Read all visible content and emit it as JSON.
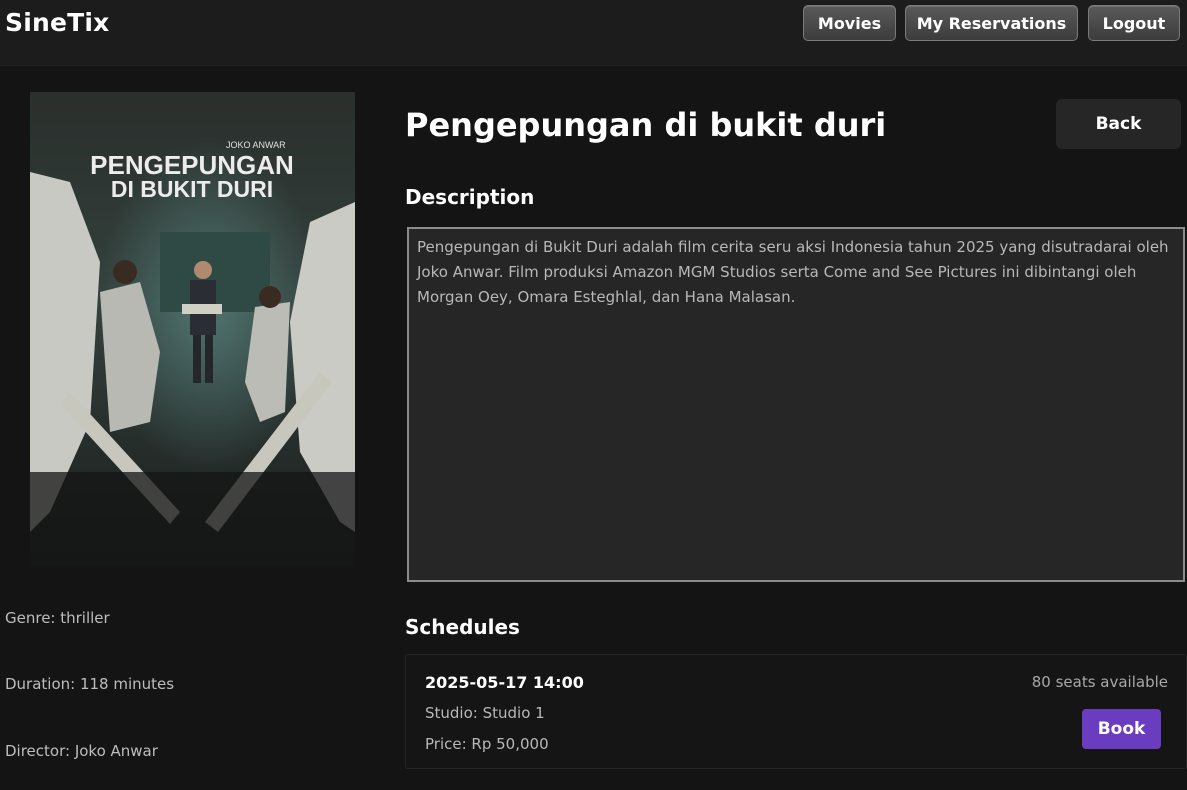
{
  "app": {
    "brand": "SineTix"
  },
  "nav": {
    "movies": "Movies",
    "reservations": "My Reservations",
    "logout": "Logout"
  },
  "movie": {
    "title": "Pengepungan di bukit duri",
    "poster": {
      "icon": "movie-poster-image",
      "title_line1": "PENGEPUNGAN",
      "title_line2": "DI BUKIT DURI",
      "credit": "JOKO ANWAR"
    },
    "genre": "Genre: thriller",
    "duration": "Duration: 118 minutes",
    "director": "Director: Joko Anwar"
  },
  "actions": {
    "back": "Back"
  },
  "description": {
    "heading": "Description",
    "text": "Pengepungan di Bukit Duri adalah film cerita seru aksi Indonesia tahun 2025 yang disutradarai oleh Joko Anwar. Film produksi Amazon MGM Studios serta Come and See Pictures ini dibintangi oleh Morgan Oey, Omara Esteghlal, dan Hana Malasan."
  },
  "schedules": {
    "heading": "Schedules",
    "items": [
      {
        "datetime": "2025-05-17 14:00",
        "studio": "Studio: Studio 1",
        "price": "Price: Rp 50,000",
        "seats": "80 seats available",
        "book_label": "Book"
      }
    ]
  },
  "colors": {
    "background": "#141414",
    "header": "#1c1c1c",
    "accent": "#6a3cc0"
  }
}
